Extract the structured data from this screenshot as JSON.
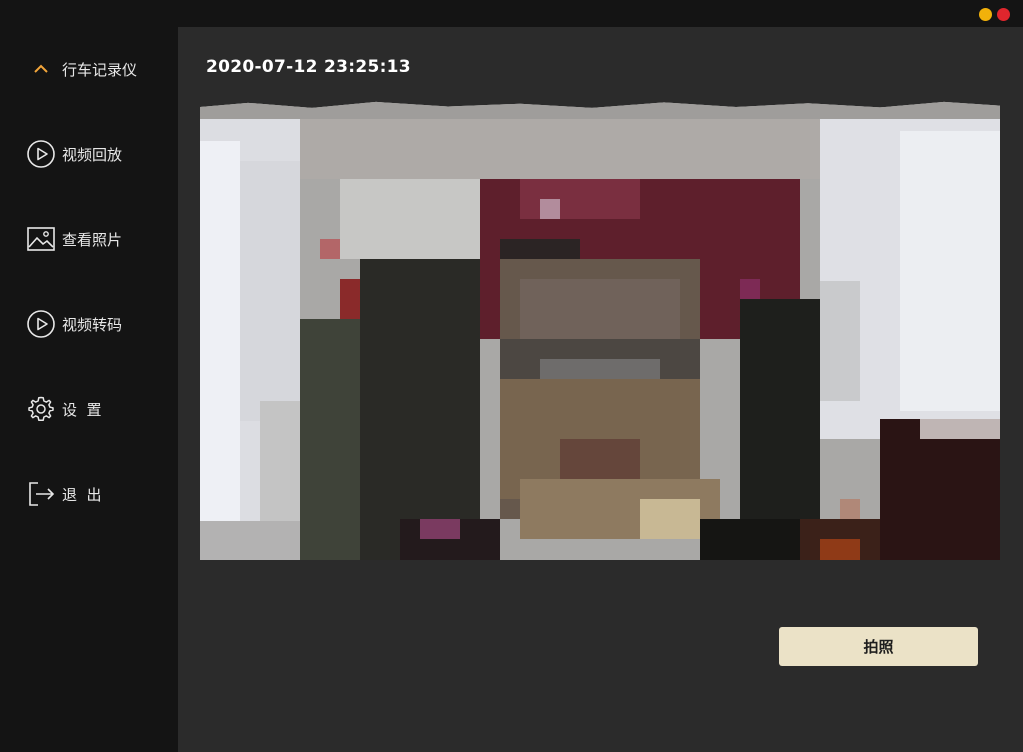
{
  "window": {
    "controls": {
      "minimize_color": "#f2b10a",
      "close_color": "#e0262d"
    }
  },
  "sidebar": {
    "items": [
      {
        "label": "行车记录仪",
        "icon": "chevron-up-icon",
        "active": true
      },
      {
        "label": "视频回放",
        "icon": "play-circle-icon"
      },
      {
        "label": "查看照片",
        "icon": "image-icon"
      },
      {
        "label": "视频转码",
        "icon": "play-circle-icon"
      },
      {
        "label": "设  置",
        "icon": "gear-icon"
      },
      {
        "label": "退  出",
        "icon": "exit-icon"
      }
    ],
    "accent_color": "#f2a53a"
  },
  "main": {
    "timestamp": "2020-07-12 23:25:13",
    "preview": {
      "content": "pixelated camera feed"
    },
    "capture_button": {
      "label": "拍照"
    }
  }
}
